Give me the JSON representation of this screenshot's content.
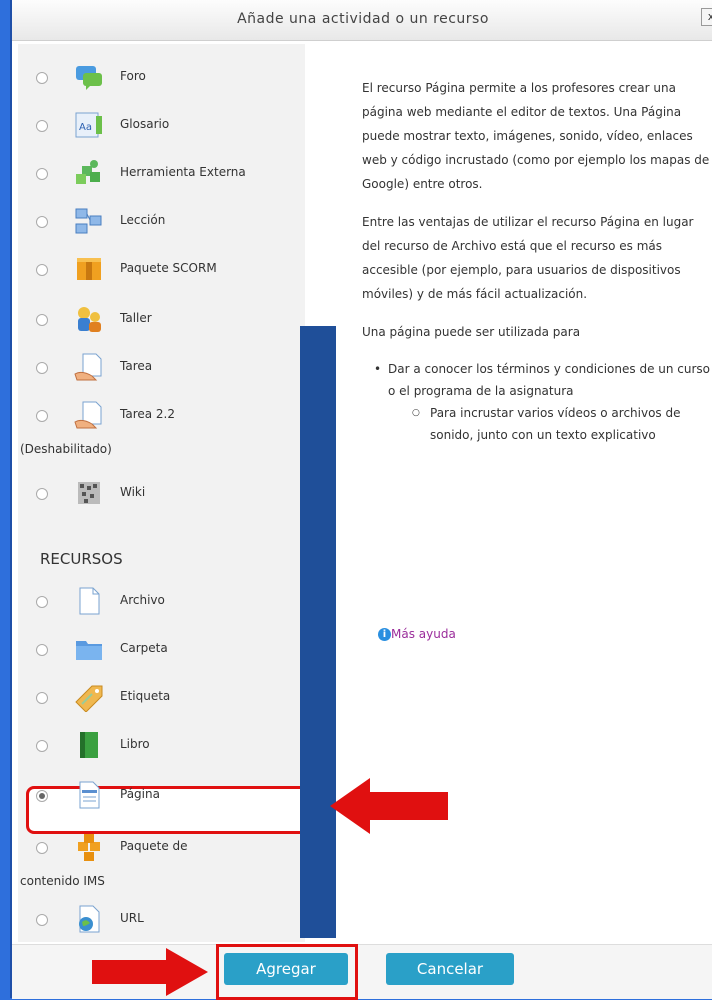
{
  "dialog": {
    "title": "Añade una actividad o un recurso",
    "close_label": "x"
  },
  "activities": [
    {
      "label": "Foro",
      "icon": "forum-icon"
    },
    {
      "label": "Glosario",
      "icon": "glossary-icon"
    },
    {
      "label": "Herramienta Externa",
      "icon": "puzzle-icon"
    },
    {
      "label": "Lección",
      "icon": "lesson-icon"
    },
    {
      "label": "Paquete SCORM",
      "icon": "scorm-package-icon"
    },
    {
      "label": "Taller",
      "icon": "workshop-icon"
    },
    {
      "label": "Tarea",
      "icon": "assignment-icon"
    },
    {
      "label": "Tarea 2.2",
      "label_extra": "(Deshabilitado)",
      "icon": "assignment-icon"
    },
    {
      "label": "Wiki",
      "icon": "wiki-icon"
    }
  ],
  "resources_header": "RECURSOS",
  "resources": [
    {
      "label": "Archivo",
      "icon": "file-icon"
    },
    {
      "label": "Carpeta",
      "icon": "folder-icon"
    },
    {
      "label": "Etiqueta",
      "icon": "label-tag-icon"
    },
    {
      "label": "Libro",
      "icon": "book-icon"
    },
    {
      "label": "Página",
      "icon": "page-icon",
      "selected": true
    },
    {
      "label": "Paquete de",
      "label_extra": "contenido IMS",
      "icon": "ims-package-icon"
    },
    {
      "label": "URL",
      "icon": "url-icon"
    }
  ],
  "description": {
    "p1": "El recurso Página permite a los profesores crear una página web mediante el editor de textos. Una Página puede mostrar texto, imágenes, sonido, vídeo, enlaces web y código incrustado (como por ejemplo los mapas de Google) entre otros.",
    "p2": "Entre las ventajas de utilizar el recurso Página en lugar del recurso de Archivo está que el recurso es más accesible (por ejemplo, para usuarios de dispositivos móviles) y de más fácil actualización.",
    "p3": "Una página puede ser utilizada para",
    "bullet1": "Dar a conocer los términos y condiciones de un curso o el programa de la asignatura",
    "subbullet1": "Para incrustar varios vídeos o archivos de sonido, junto con un texto explicativo",
    "help_link": "Más ayuda"
  },
  "footer": {
    "add_label": "Agregar",
    "cancel_label": "Cancelar"
  },
  "colors": {
    "background": "#2e6fdc",
    "button": "#2aa0c8",
    "highlight": "#e01010",
    "scrollbar": "#1f4f99"
  }
}
